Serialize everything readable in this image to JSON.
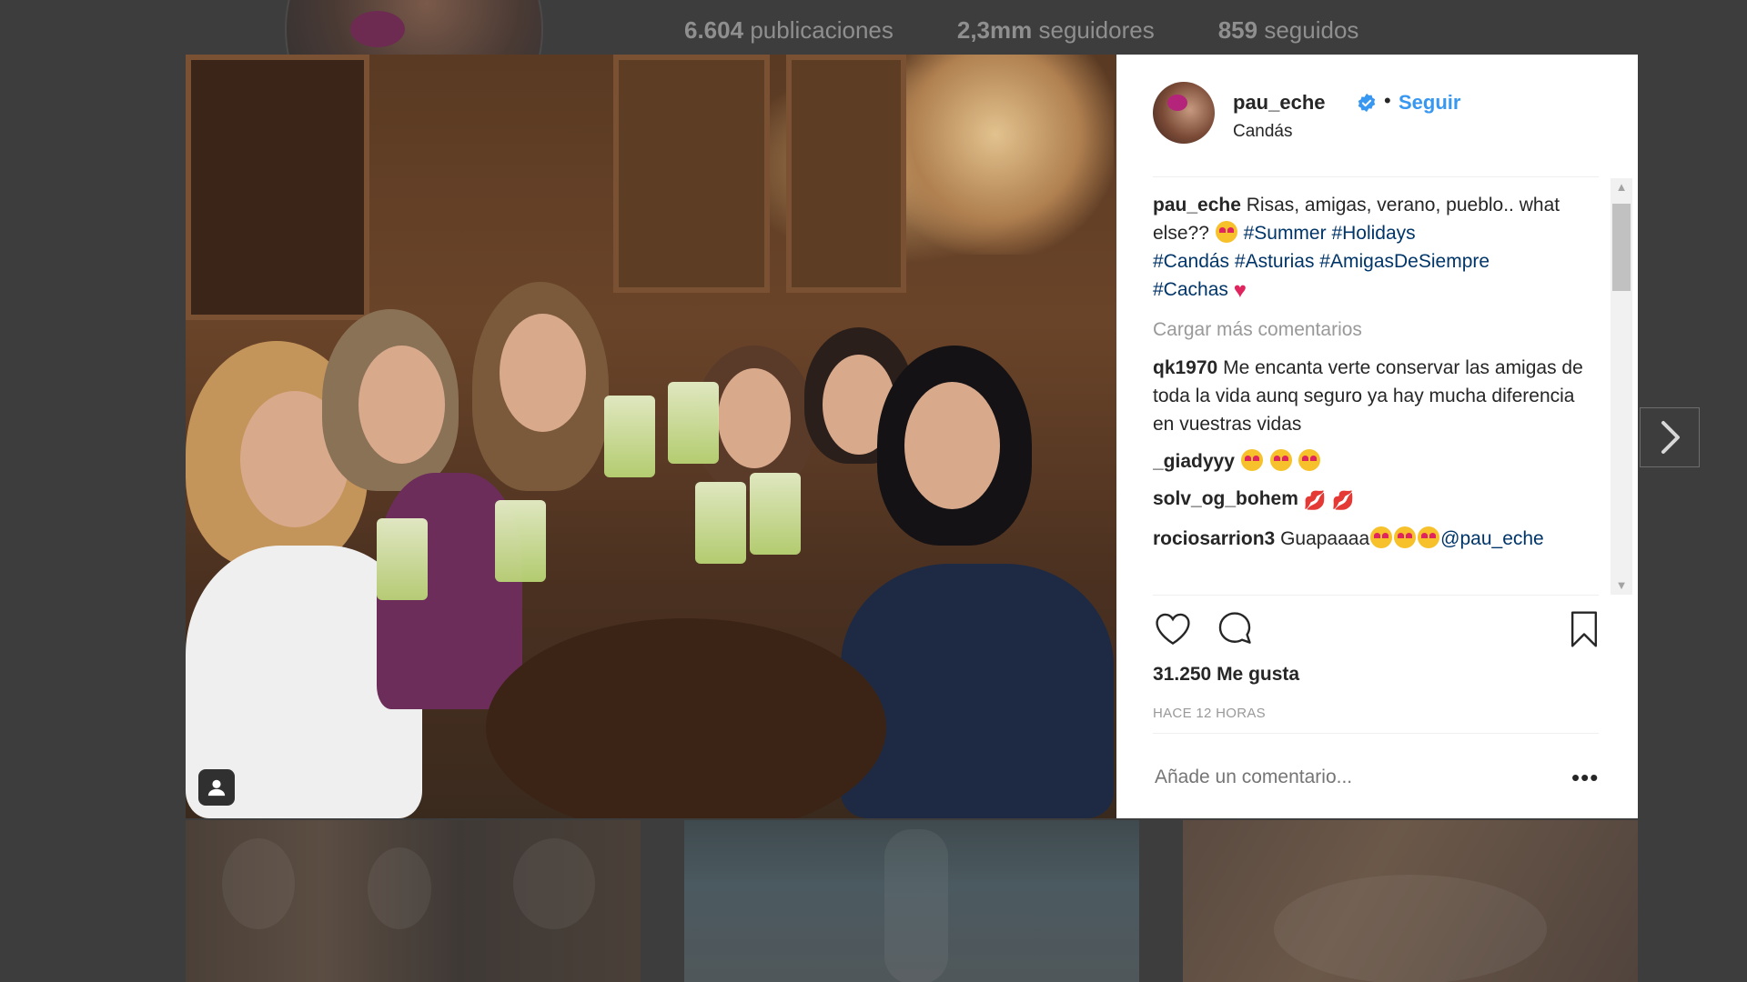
{
  "background_profile": {
    "stats": [
      {
        "count": "6.604",
        "label": "publicaciones"
      },
      {
        "count": "2,3mm",
        "label": "seguidores"
      },
      {
        "count": "859",
        "label": "seguidos"
      }
    ]
  },
  "post": {
    "author": {
      "username": "pau_eche",
      "verified": true,
      "follow_label": "Seguir",
      "separator": "•",
      "location": "Candás"
    },
    "caption": {
      "username": "pau_eche",
      "text": "Risas, amigas, verano, pueblo.. what else??",
      "hashtags": [
        "#Summer",
        "#Holidays",
        "#Candás",
        "#Asturias",
        "#AmigasDeSiempre",
        "#Cachas"
      ]
    },
    "load_more_label": "Cargar más comentarios",
    "comments": [
      {
        "username": "qk1970",
        "text": "Me encanta verte conservar las amigas de toda la vida aunq seguro ya hay mucha diferencia en vuestras vidas"
      },
      {
        "username": "_giadyyy",
        "text": ""
      },
      {
        "username": "solv_og_bohem",
        "text": ""
      },
      {
        "username": "rociosarrion3",
        "text": "Guapaaaa",
        "mention": "@pau_eche"
      }
    ],
    "likes_label": "31.250 Me gusta",
    "time_label": "HACE 12 HORAS",
    "add_comment_placeholder": "Añade un comentario...",
    "more_label": "•••"
  },
  "icons": {
    "verified": "verified-badge-icon",
    "like": "heart-outline-icon",
    "comment": "speech-bubble-icon",
    "save": "bookmark-icon",
    "next": "chevron-right-icon",
    "user_tag": "person-icon"
  },
  "colors": {
    "link_blue": "#3897f0",
    "hashtag_blue": "#003569",
    "text": "#262626",
    "muted": "#999999",
    "overlay": "#3b3b3b"
  }
}
